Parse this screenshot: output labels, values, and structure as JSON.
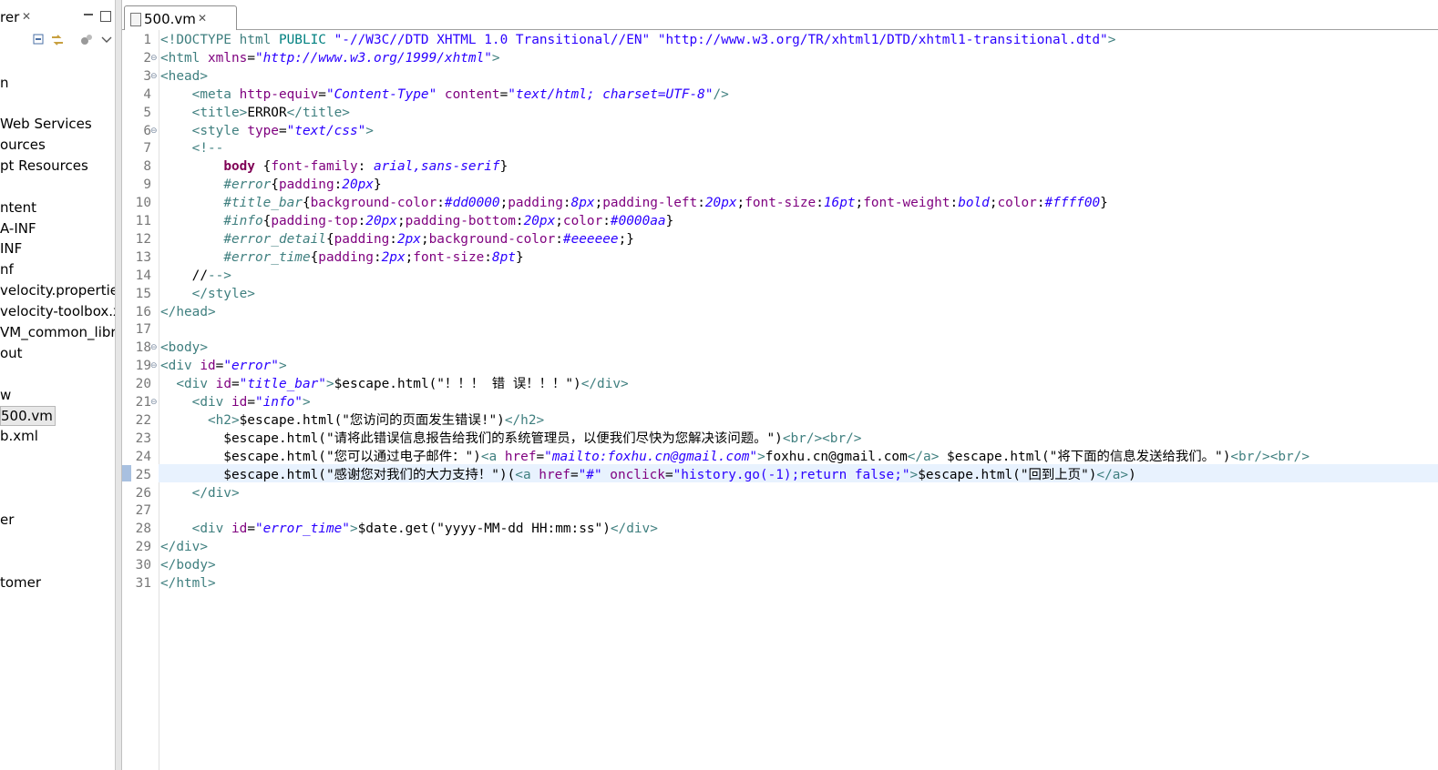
{
  "explorer": {
    "tab_label": "rer",
    "tab_close": "✕",
    "items": [
      {
        "label": "n",
        "selected": false
      },
      {
        "label": " Web Services",
        "selected": false
      },
      {
        "label": "ources",
        "selected": false
      },
      {
        "label": "pt Resources",
        "selected": false
      },
      {
        "label": "ntent",
        "selected": false
      },
      {
        "label": "A-INF",
        "selected": false
      },
      {
        "label": "INF",
        "selected": false
      },
      {
        "label": "nf",
        "selected": false
      },
      {
        "label": "velocity.propertie",
        "selected": false
      },
      {
        "label": "velocity-toolbox.x",
        "selected": false
      },
      {
        "label": "VM_common_libr",
        "selected": false
      },
      {
        "label": "out",
        "selected": false
      },
      {
        "label": "w",
        "selected": false
      },
      {
        "label": "500.vm",
        "selected": true
      },
      {
        "label": "b.xml",
        "selected": false
      },
      {
        "label": "er",
        "selected": false
      },
      {
        "label": "tomer",
        "selected": false
      }
    ]
  },
  "editor": {
    "tab_label": "500.vm",
    "tab_close": "✕",
    "current_line": 25
  },
  "colors": {
    "tag": "#3f7f7f",
    "attribute": "#7f007f",
    "value": "#2a00ff",
    "comment": "#3f5fbf",
    "current_line": "#e8f2fe"
  },
  "code_lines": [
    {
      "n": "1",
      "fold": false,
      "tokens": [
        [
          "tg",
          "<!DOCTYPE html "
        ],
        [
          "dc",
          "PUBLIC "
        ],
        [
          "av-n",
          "\"-//W3C//DTD XHTML 1.0 Transitional//EN\" \"http://www.w3.org/TR/xhtml1/DTD/xhtml1-transitional.dtd\""
        ],
        [
          "tg",
          ">"
        ]
      ]
    },
    {
      "n": "2",
      "fold": true,
      "tokens": [
        [
          "tg",
          "<html "
        ],
        [
          "at",
          "xmlns"
        ],
        [
          "p",
          "="
        ],
        [
          "av",
          "\"http://www.w3.org/1999/xhtml\""
        ],
        [
          "tg",
          ">"
        ]
      ]
    },
    {
      "n": "3",
      "fold": true,
      "tokens": [
        [
          "tg",
          "<head>"
        ]
      ]
    },
    {
      "n": "4",
      "fold": false,
      "tokens": [
        [
          "p",
          "    "
        ],
        [
          "tg",
          "<meta "
        ],
        [
          "at",
          "http-equiv"
        ],
        [
          "p",
          "="
        ],
        [
          "av",
          "\"Content-Type\""
        ],
        [
          "p",
          " "
        ],
        [
          "at",
          "content"
        ],
        [
          "p",
          "="
        ],
        [
          "av",
          "\"text/html; charset=UTF-8\""
        ],
        [
          "tg",
          "/>"
        ]
      ]
    },
    {
      "n": "5",
      "fold": false,
      "tokens": [
        [
          "p",
          "    "
        ],
        [
          "tg",
          "<title>"
        ],
        [
          "p",
          "ERROR"
        ],
        [
          "tg",
          "</title>"
        ]
      ]
    },
    {
      "n": "6",
      "fold": true,
      "tokens": [
        [
          "p",
          "    "
        ],
        [
          "tg",
          "<style "
        ],
        [
          "at",
          "type"
        ],
        [
          "p",
          "="
        ],
        [
          "av",
          "\"text/css\""
        ],
        [
          "tg",
          ">"
        ]
      ]
    },
    {
      "n": "7",
      "fold": false,
      "tokens": [
        [
          "p",
          "    "
        ],
        [
          "tg",
          "<!--"
        ]
      ]
    },
    {
      "n": "8",
      "fold": false,
      "tokens": [
        [
          "p",
          "        "
        ],
        [
          "b",
          "body "
        ],
        [
          "p",
          "{"
        ],
        [
          "at",
          "font-family"
        ],
        [
          "p",
          ": "
        ],
        [
          "cv",
          "arial,sans-serif"
        ],
        [
          "p",
          "}"
        ]
      ]
    },
    {
      "n": "9",
      "fold": false,
      "tokens": [
        [
          "p",
          "        "
        ],
        [
          "cs",
          "#error"
        ],
        [
          "p",
          "{"
        ],
        [
          "at",
          "padding"
        ],
        [
          "p",
          ":"
        ],
        [
          "cv",
          "20px"
        ],
        [
          "p",
          "}"
        ]
      ]
    },
    {
      "n": "10",
      "fold": false,
      "tokens": [
        [
          "p",
          "        "
        ],
        [
          "cs",
          "#title_bar"
        ],
        [
          "p",
          "{"
        ],
        [
          "at",
          "background-color"
        ],
        [
          "p",
          ":"
        ],
        [
          "cv",
          "#dd0000"
        ],
        [
          "p",
          ";"
        ],
        [
          "at",
          "padding"
        ],
        [
          "p",
          ":"
        ],
        [
          "cv",
          "8px"
        ],
        [
          "p",
          ";"
        ],
        [
          "at",
          "padding-left"
        ],
        [
          "p",
          ":"
        ],
        [
          "cv",
          "20px"
        ],
        [
          "p",
          ";"
        ],
        [
          "at",
          "font-size"
        ],
        [
          "p",
          ":"
        ],
        [
          "cv",
          "16pt"
        ],
        [
          "p",
          ";"
        ],
        [
          "at",
          "font-weight"
        ],
        [
          "p",
          ":"
        ],
        [
          "cv",
          "bold"
        ],
        [
          "p",
          ";"
        ],
        [
          "at",
          "color"
        ],
        [
          "p",
          ":"
        ],
        [
          "cv",
          "#ffff00"
        ],
        [
          "p",
          "}"
        ]
      ]
    },
    {
      "n": "11",
      "fold": false,
      "tokens": [
        [
          "p",
          "        "
        ],
        [
          "cs",
          "#info"
        ],
        [
          "p",
          "{"
        ],
        [
          "at",
          "padding-top"
        ],
        [
          "p",
          ":"
        ],
        [
          "cv",
          "20px"
        ],
        [
          "p",
          ";"
        ],
        [
          "at",
          "padding-bottom"
        ],
        [
          "p",
          ":"
        ],
        [
          "cv",
          "20px"
        ],
        [
          "p",
          ";"
        ],
        [
          "at",
          "color"
        ],
        [
          "p",
          ":"
        ],
        [
          "cv",
          "#0000aa"
        ],
        [
          "p",
          "}"
        ]
      ]
    },
    {
      "n": "12",
      "fold": false,
      "tokens": [
        [
          "p",
          "        "
        ],
        [
          "cs",
          "#error_detail"
        ],
        [
          "p",
          "{"
        ],
        [
          "at",
          "padding"
        ],
        [
          "p",
          ":"
        ],
        [
          "cv",
          "2px"
        ],
        [
          "p",
          ";"
        ],
        [
          "at",
          "background-color"
        ],
        [
          "p",
          ":"
        ],
        [
          "cv",
          "#eeeeee"
        ],
        [
          "p",
          ";}"
        ]
      ]
    },
    {
      "n": "13",
      "fold": false,
      "tokens": [
        [
          "p",
          "        "
        ],
        [
          "cs",
          "#error_time"
        ],
        [
          "p",
          "{"
        ],
        [
          "at",
          "padding"
        ],
        [
          "p",
          ":"
        ],
        [
          "cv",
          "2px"
        ],
        [
          "p",
          ";"
        ],
        [
          "at",
          "font-size"
        ],
        [
          "p",
          ":"
        ],
        [
          "cv",
          "8pt"
        ],
        [
          "p",
          "}"
        ]
      ]
    },
    {
      "n": "14",
      "fold": false,
      "tokens": [
        [
          "p",
          "    //"
        ],
        [
          "tg",
          "-->"
        ]
      ]
    },
    {
      "n": "15",
      "fold": false,
      "tokens": [
        [
          "p",
          "    "
        ],
        [
          "tg",
          "</style>"
        ]
      ]
    },
    {
      "n": "16",
      "fold": false,
      "tokens": [
        [
          "tg",
          "</head>"
        ]
      ]
    },
    {
      "n": "17",
      "fold": false,
      "tokens": []
    },
    {
      "n": "18",
      "fold": true,
      "tokens": [
        [
          "tg",
          "<body>"
        ]
      ]
    },
    {
      "n": "19",
      "fold": true,
      "tokens": [
        [
          "tg",
          "<div "
        ],
        [
          "at",
          "id"
        ],
        [
          "p",
          "="
        ],
        [
          "av",
          "\"error\""
        ],
        [
          "tg",
          ">"
        ]
      ]
    },
    {
      "n": "20",
      "fold": false,
      "tokens": [
        [
          "p",
          "  "
        ],
        [
          "tg",
          "<div "
        ],
        [
          "at",
          "id"
        ],
        [
          "p",
          "="
        ],
        [
          "av",
          "\"title_bar\""
        ],
        [
          "tg",
          ">"
        ],
        [
          "p",
          "$escape.html(\"！！！ 错 误！！！\")"
        ],
        [
          "tg",
          "</div>"
        ]
      ]
    },
    {
      "n": "21",
      "fold": true,
      "tokens": [
        [
          "p",
          "    "
        ],
        [
          "tg",
          "<div "
        ],
        [
          "at",
          "id"
        ],
        [
          "p",
          "="
        ],
        [
          "av",
          "\"info\""
        ],
        [
          "tg",
          ">"
        ]
      ]
    },
    {
      "n": "22",
      "fold": false,
      "tokens": [
        [
          "p",
          "      "
        ],
        [
          "tg",
          "<h2>"
        ],
        [
          "p",
          "$escape.html(\"您访问的页面发生错误!\")"
        ],
        [
          "tg",
          "</h2>"
        ]
      ]
    },
    {
      "n": "23",
      "fold": false,
      "tokens": [
        [
          "p",
          "        $escape.html(\"请将此错误信息报告给我们的系统管理员，以便我们尽快为您解决该问题。\")"
        ],
        [
          "tg",
          "<br/><br/>"
        ]
      ]
    },
    {
      "n": "24",
      "fold": false,
      "tokens": [
        [
          "p",
          "        $escape.html(\"您可以通过电子邮件：\")"
        ],
        [
          "tg",
          "<a "
        ],
        [
          "at",
          "href"
        ],
        [
          "p",
          "="
        ],
        [
          "av",
          "\"mailto:foxhu.cn@gmail.com\""
        ],
        [
          "tg",
          ">"
        ],
        [
          "p",
          "foxhu.cn@gmail.com"
        ],
        [
          "tg",
          "</a>"
        ],
        [
          "p",
          " $escape.html(\"将下面的信息发送给我们。\")"
        ],
        [
          "tg",
          "<br/><br/>"
        ]
      ]
    },
    {
      "n": "25",
      "fold": false,
      "tokens": [
        [
          "p",
          "        $escape.html(\"感谢您对我们的大力支持！\")("
        ],
        [
          "tg",
          "<a "
        ],
        [
          "at",
          "href"
        ],
        [
          "p",
          "="
        ],
        [
          "av-n",
          "\"#\""
        ],
        [
          "p",
          " "
        ],
        [
          "at",
          "onclick"
        ],
        [
          "p",
          "="
        ],
        [
          "av-n",
          "\"history.go(-1);return false;\""
        ],
        [
          "tg",
          ">"
        ],
        [
          "p",
          "$escape.html(\"回到上页\")"
        ],
        [
          "tg",
          "</a>"
        ],
        [
          "p",
          ")"
        ]
      ]
    },
    {
      "n": "26",
      "fold": false,
      "tokens": [
        [
          "p",
          "    "
        ],
        [
          "tg",
          "</div>"
        ]
      ]
    },
    {
      "n": "27",
      "fold": false,
      "tokens": []
    },
    {
      "n": "28",
      "fold": false,
      "tokens": [
        [
          "p",
          "    "
        ],
        [
          "tg",
          "<div "
        ],
        [
          "at",
          "id"
        ],
        [
          "p",
          "="
        ],
        [
          "av",
          "\"error_time\""
        ],
        [
          "tg",
          ">"
        ],
        [
          "p",
          "$date.get(\"yyyy-MM-dd HH:mm:ss\")"
        ],
        [
          "tg",
          "</div>"
        ]
      ]
    },
    {
      "n": "29",
      "fold": false,
      "tokens": [
        [
          "tg",
          "</div>"
        ]
      ]
    },
    {
      "n": "30",
      "fold": false,
      "tokens": [
        [
          "tg",
          "</body>"
        ]
      ]
    },
    {
      "n": "31",
      "fold": false,
      "tokens": [
        [
          "tg",
          "</html>"
        ]
      ]
    }
  ]
}
